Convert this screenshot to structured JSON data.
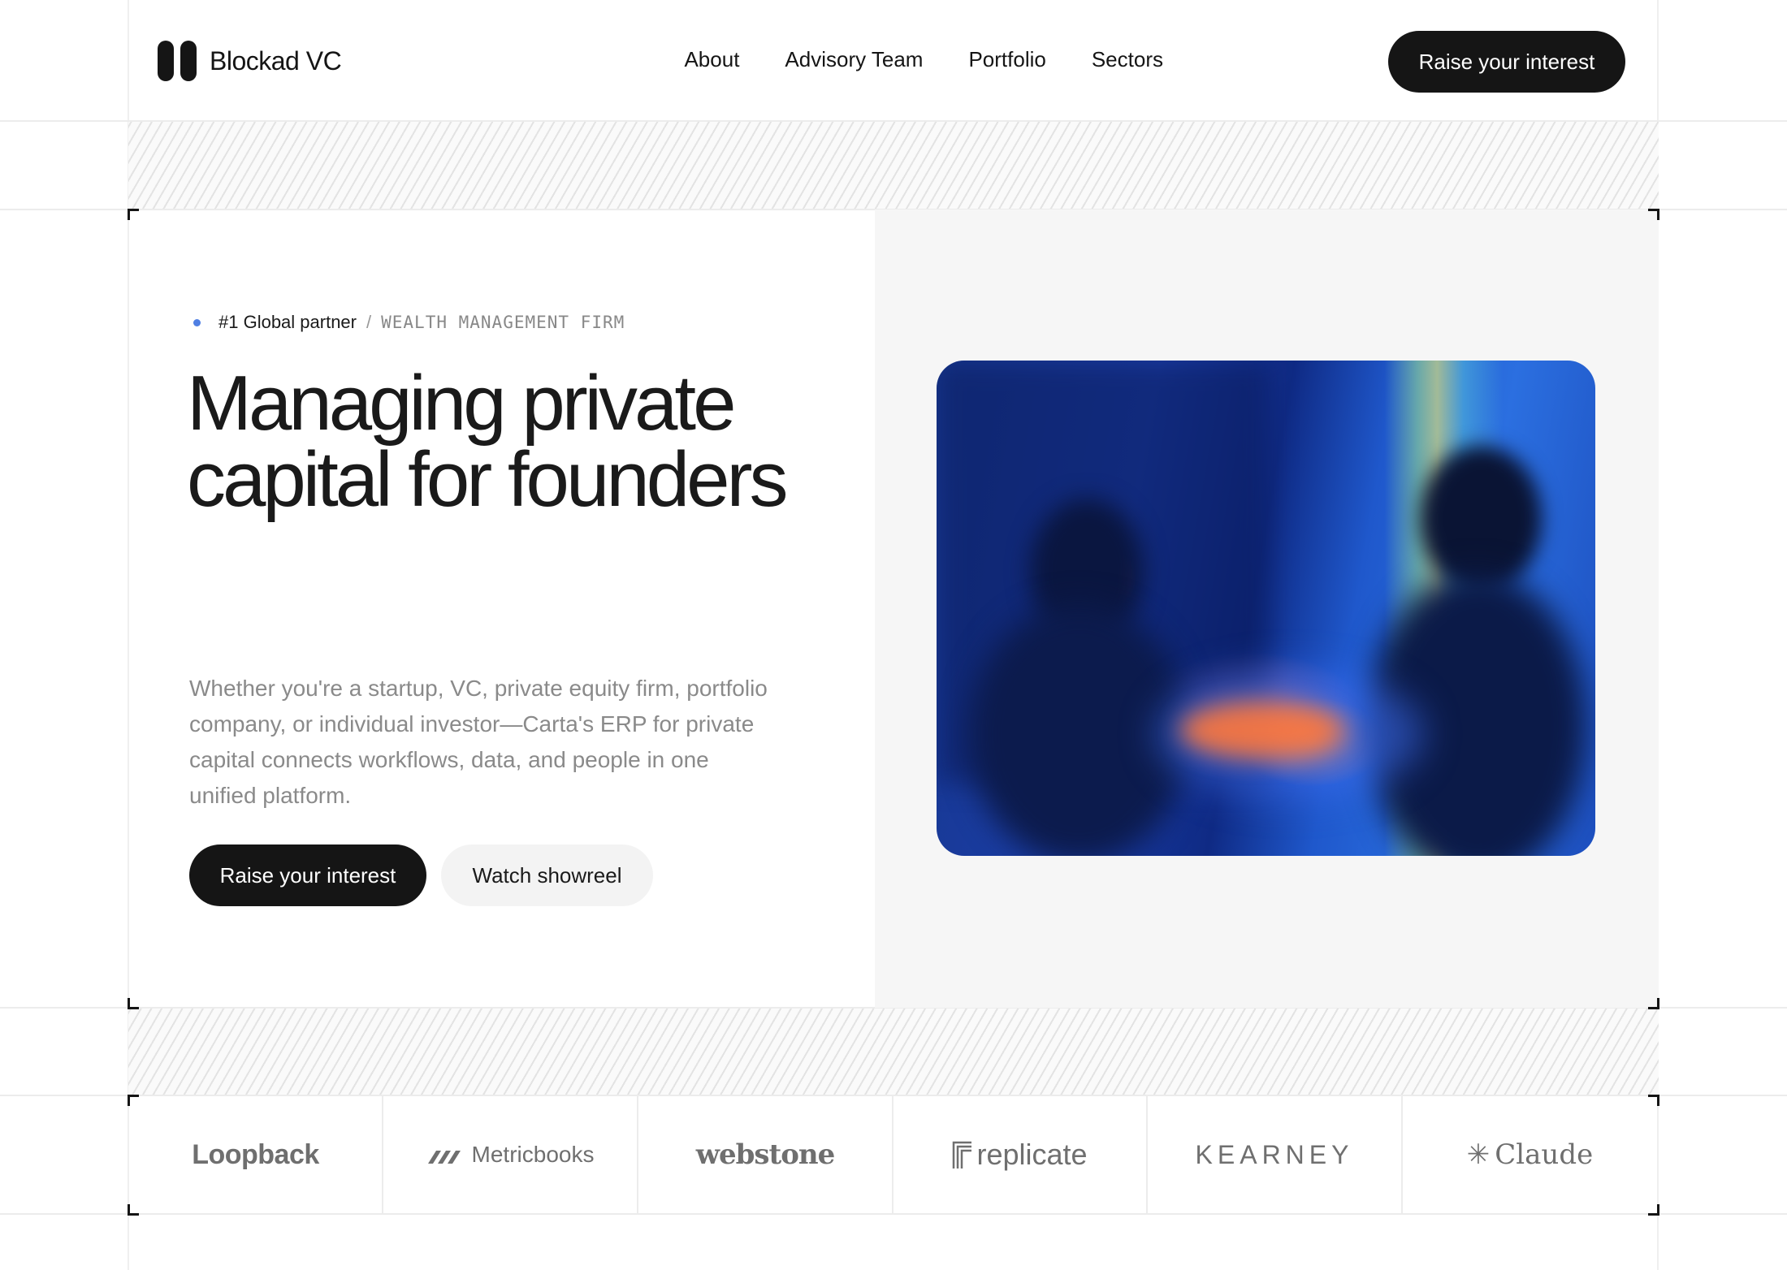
{
  "brand": {
    "name": "Blockad VC"
  },
  "nav": {
    "items": [
      "About",
      "Advisory Team",
      "Portfolio",
      "Sectors"
    ],
    "cta": "Raise your interest"
  },
  "hero": {
    "tag_main": "#1 Global partner",
    "tag_separator": "/",
    "tag_sub": "WEALTH MANAGEMENT FIRM",
    "headline_line1": "Managing private",
    "headline_line2": "capital for founders",
    "description": "Whether you're a startup, VC, private equity firm, portfolio company, or individual investor—Carta's ERP for private capital connects workflows, data, and people in one unified platform.",
    "primary_button": "Raise your interest",
    "secondary_button": "Watch showreel"
  },
  "logos": [
    "Loopback",
    "Metricbooks",
    "webstone",
    "replicate",
    "KEARNEY",
    "Claude"
  ],
  "colors": {
    "dark": "#151515",
    "accent_dot": "#4f7fe3",
    "panel": "#f6f6f6"
  }
}
